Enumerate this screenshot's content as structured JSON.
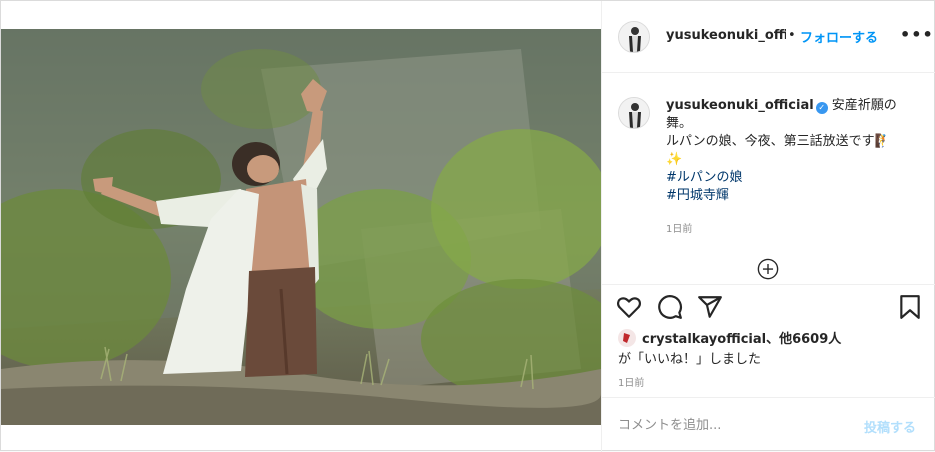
{
  "header": {
    "username": "yusukeonuki_official",
    "separator": "•",
    "follow_label": "フォローする",
    "more_label": "•••"
  },
  "caption": {
    "username": "yusukeonuki_official",
    "verified_icon": "verified-badge-icon",
    "line1": "安産祈願の舞。",
    "line2": "ルパンの娘、今夜、第三話放送です",
    "line2_emoji": "🧗",
    "sparkle": "✨",
    "hashtags": [
      "#ルパンの娘",
      "#円城寺輝"
    ],
    "time": "1日前"
  },
  "actions": {
    "like_icon": "heart-icon",
    "comment_icon": "comment-icon",
    "share_icon": "share-icon",
    "save_icon": "bookmark-icon",
    "more_comments_icon": "plus-circle-icon"
  },
  "likes": {
    "liker": "crystalkayofficial",
    "others": "、他6609人",
    "suffix": "が「いいね！」しました",
    "time": "1日前"
  },
  "comment_box": {
    "placeholder": "コメントを追加...",
    "post_label": "投稿する"
  },
  "colors": {
    "accent": "#0095f6",
    "post_disabled": "#b2dffc",
    "hashtag": "#00376b",
    "muted": "#8e8e8e",
    "verified": "#3897f0"
  }
}
